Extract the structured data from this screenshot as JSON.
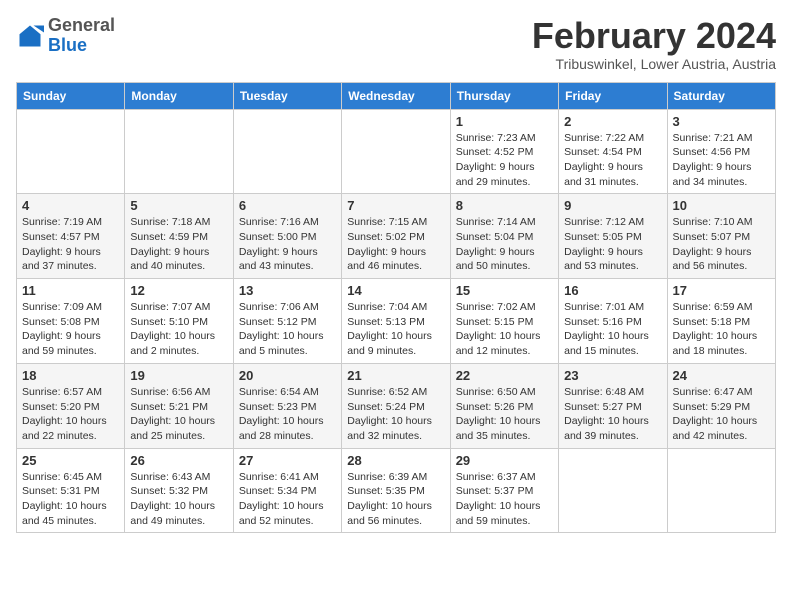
{
  "header": {
    "logo": {
      "general": "General",
      "blue": "Blue"
    },
    "title": "February 2024",
    "location": "Tribuswinkel, Lower Austria, Austria"
  },
  "weekdays": [
    "Sunday",
    "Monday",
    "Tuesday",
    "Wednesday",
    "Thursday",
    "Friday",
    "Saturday"
  ],
  "weeks": [
    [
      {
        "day": "",
        "info": ""
      },
      {
        "day": "",
        "info": ""
      },
      {
        "day": "",
        "info": ""
      },
      {
        "day": "",
        "info": ""
      },
      {
        "day": "1",
        "info": "Sunrise: 7:23 AM\nSunset: 4:52 PM\nDaylight: 9 hours and 29 minutes."
      },
      {
        "day": "2",
        "info": "Sunrise: 7:22 AM\nSunset: 4:54 PM\nDaylight: 9 hours and 31 minutes."
      },
      {
        "day": "3",
        "info": "Sunrise: 7:21 AM\nSunset: 4:56 PM\nDaylight: 9 hours and 34 minutes."
      }
    ],
    [
      {
        "day": "4",
        "info": "Sunrise: 7:19 AM\nSunset: 4:57 PM\nDaylight: 9 hours and 37 minutes."
      },
      {
        "day": "5",
        "info": "Sunrise: 7:18 AM\nSunset: 4:59 PM\nDaylight: 9 hours and 40 minutes."
      },
      {
        "day": "6",
        "info": "Sunrise: 7:16 AM\nSunset: 5:00 PM\nDaylight: 9 hours and 43 minutes."
      },
      {
        "day": "7",
        "info": "Sunrise: 7:15 AM\nSunset: 5:02 PM\nDaylight: 9 hours and 46 minutes."
      },
      {
        "day": "8",
        "info": "Sunrise: 7:14 AM\nSunset: 5:04 PM\nDaylight: 9 hours and 50 minutes."
      },
      {
        "day": "9",
        "info": "Sunrise: 7:12 AM\nSunset: 5:05 PM\nDaylight: 9 hours and 53 minutes."
      },
      {
        "day": "10",
        "info": "Sunrise: 7:10 AM\nSunset: 5:07 PM\nDaylight: 9 hours and 56 minutes."
      }
    ],
    [
      {
        "day": "11",
        "info": "Sunrise: 7:09 AM\nSunset: 5:08 PM\nDaylight: 9 hours and 59 minutes."
      },
      {
        "day": "12",
        "info": "Sunrise: 7:07 AM\nSunset: 5:10 PM\nDaylight: 10 hours and 2 minutes."
      },
      {
        "day": "13",
        "info": "Sunrise: 7:06 AM\nSunset: 5:12 PM\nDaylight: 10 hours and 5 minutes."
      },
      {
        "day": "14",
        "info": "Sunrise: 7:04 AM\nSunset: 5:13 PM\nDaylight: 10 hours and 9 minutes."
      },
      {
        "day": "15",
        "info": "Sunrise: 7:02 AM\nSunset: 5:15 PM\nDaylight: 10 hours and 12 minutes."
      },
      {
        "day": "16",
        "info": "Sunrise: 7:01 AM\nSunset: 5:16 PM\nDaylight: 10 hours and 15 minutes."
      },
      {
        "day": "17",
        "info": "Sunrise: 6:59 AM\nSunset: 5:18 PM\nDaylight: 10 hours and 18 minutes."
      }
    ],
    [
      {
        "day": "18",
        "info": "Sunrise: 6:57 AM\nSunset: 5:20 PM\nDaylight: 10 hours and 22 minutes."
      },
      {
        "day": "19",
        "info": "Sunrise: 6:56 AM\nSunset: 5:21 PM\nDaylight: 10 hours and 25 minutes."
      },
      {
        "day": "20",
        "info": "Sunrise: 6:54 AM\nSunset: 5:23 PM\nDaylight: 10 hours and 28 minutes."
      },
      {
        "day": "21",
        "info": "Sunrise: 6:52 AM\nSunset: 5:24 PM\nDaylight: 10 hours and 32 minutes."
      },
      {
        "day": "22",
        "info": "Sunrise: 6:50 AM\nSunset: 5:26 PM\nDaylight: 10 hours and 35 minutes."
      },
      {
        "day": "23",
        "info": "Sunrise: 6:48 AM\nSunset: 5:27 PM\nDaylight: 10 hours and 39 minutes."
      },
      {
        "day": "24",
        "info": "Sunrise: 6:47 AM\nSunset: 5:29 PM\nDaylight: 10 hours and 42 minutes."
      }
    ],
    [
      {
        "day": "25",
        "info": "Sunrise: 6:45 AM\nSunset: 5:31 PM\nDaylight: 10 hours and 45 minutes."
      },
      {
        "day": "26",
        "info": "Sunrise: 6:43 AM\nSunset: 5:32 PM\nDaylight: 10 hours and 49 minutes."
      },
      {
        "day": "27",
        "info": "Sunrise: 6:41 AM\nSunset: 5:34 PM\nDaylight: 10 hours and 52 minutes."
      },
      {
        "day": "28",
        "info": "Sunrise: 6:39 AM\nSunset: 5:35 PM\nDaylight: 10 hours and 56 minutes."
      },
      {
        "day": "29",
        "info": "Sunrise: 6:37 AM\nSunset: 5:37 PM\nDaylight: 10 hours and 59 minutes."
      },
      {
        "day": "",
        "info": ""
      },
      {
        "day": "",
        "info": ""
      }
    ]
  ]
}
